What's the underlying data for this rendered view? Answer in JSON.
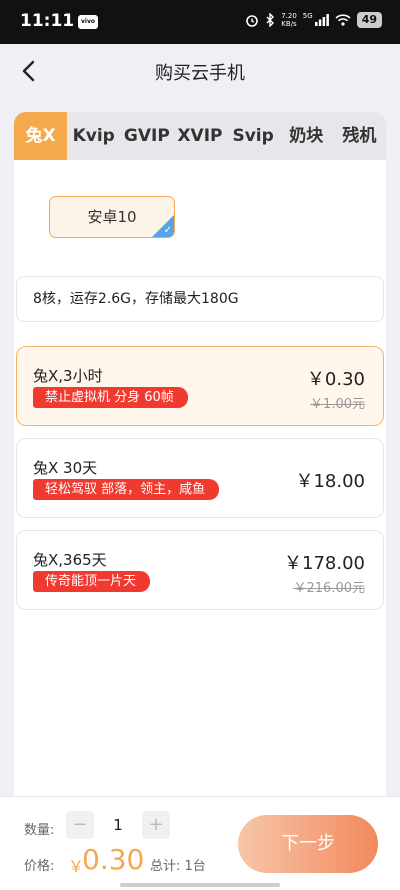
{
  "status_bar": {
    "time": "11:11",
    "app_chip": "vivo",
    "net_speed_value": "7.20",
    "net_speed_unit": "KB/s",
    "signal": "5G",
    "battery": "49"
  },
  "header": {
    "title": "购买云手机"
  },
  "tabs": [
    {
      "label": "兔X",
      "active": true
    },
    {
      "label": "Kvip"
    },
    {
      "label": "GVIP"
    },
    {
      "label": "XVIP"
    },
    {
      "label": "Svip"
    },
    {
      "label": "奶块"
    },
    {
      "label": "残机"
    }
  ],
  "os_option": {
    "label": "安卓10",
    "selected": true
  },
  "specs": "8核，运存2.6G，存储最大180G",
  "plans": [
    {
      "name": "兔X,3小时",
      "tag": "禁止虚拟机 分身 60帧",
      "price": "￥0.30",
      "original": "￥1.00元",
      "selected": true
    },
    {
      "name": "兔X 30天",
      "tag": "轻松驾驭 部落，领主，咸鱼",
      "price": "￥18.00",
      "original": ""
    },
    {
      "name": "兔X,365天",
      "tag": "传奇能顶一片天",
      "price": "￥178.00",
      "original": "￥216.00元"
    }
  ],
  "bottom": {
    "qty_label": "数量:",
    "qty_minus": "−",
    "qty_value": "1",
    "qty_plus": "+",
    "price_label": "价格:",
    "currency": "￥",
    "total_price": "0.30",
    "total_label": "总计: 1台",
    "next_label": "下一步"
  },
  "colors": {
    "accent": "#f6a84c",
    "tag_red": "#f03a30",
    "check_blue": "#5aa2e6"
  }
}
